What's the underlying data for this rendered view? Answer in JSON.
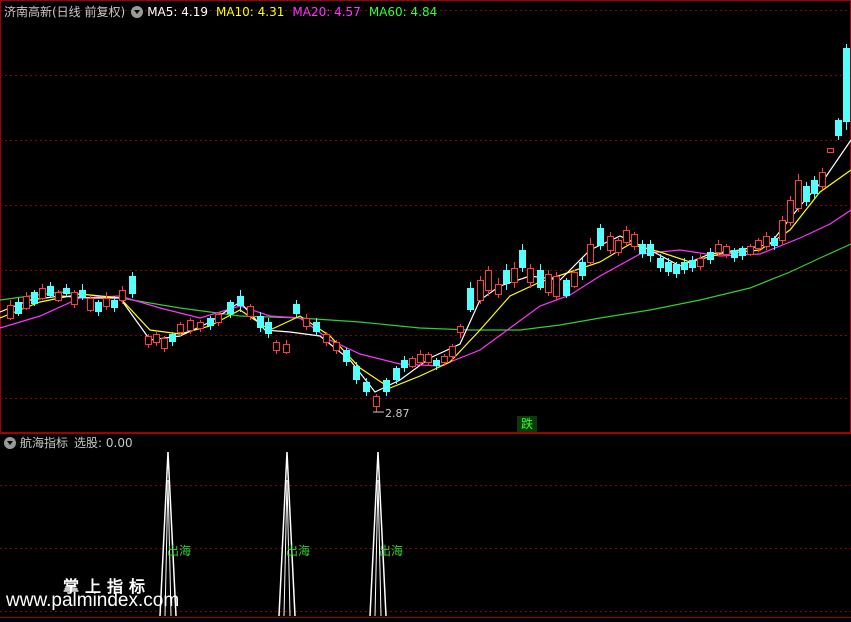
{
  "main_panel": {
    "title": "济南高新(日线 前复权)",
    "ma_labels": [
      {
        "text": "MA5: 4.19",
        "color": "#ffffff"
      },
      {
        "text": "MA10: 4.31",
        "color": "#ffff00"
      },
      {
        "text": "MA20: 4.57",
        "color": "#ff33ff"
      },
      {
        "text": "MA60: 4.84",
        "color": "#33ff33"
      }
    ],
    "low_marker": "2.87",
    "signal_badge": "跌"
  },
  "indicator_panel": {
    "title": "航海指标",
    "value_label": "选股: 0.00",
    "signals": [
      "出海",
      "出海",
      "出海"
    ]
  },
  "watermark": {
    "line1": "掌上指标",
    "line2": "www.palmindex.com"
  },
  "colors": {
    "up": "#ff3c3c",
    "down": "#54ffff",
    "ma5": "#ffffff",
    "ma10": "#ffff00",
    "ma20": "#ff33ff",
    "ma60": "#33cc33",
    "grid": "#8b0000",
    "border": "#a00000"
  },
  "chart_data": {
    "type": "candlestick",
    "ma_last": {
      "MA5": 4.19,
      "MA10": 4.31,
      "MA20": 4.57,
      "MA60": 4.84
    },
    "min_low": 2.87
  }
}
